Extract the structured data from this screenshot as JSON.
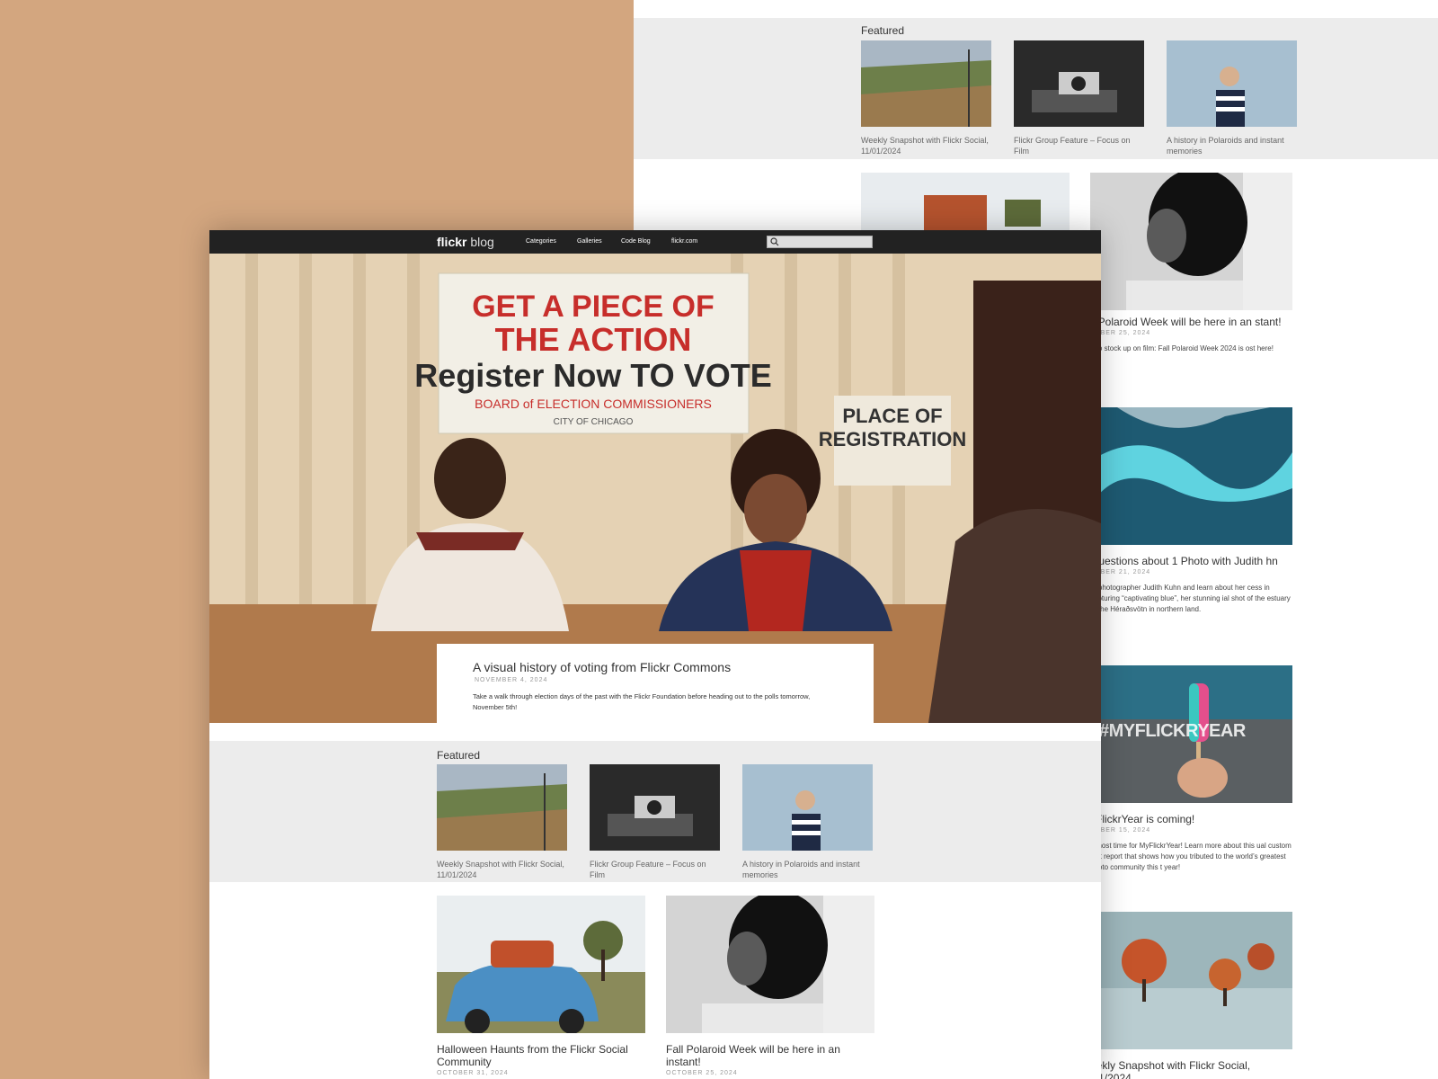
{
  "back": {
    "featured_label": "Featured",
    "featured": [
      {
        "caption": "Weekly Snapshot with Flickr Social, 11/01/2024",
        "image": "landscape-chairlift"
      },
      {
        "caption": "Flickr Group Feature – Focus on Film",
        "image": "camera-on-book"
      },
      {
        "caption": "A history in Polaroids and instant memories",
        "image": "boy-striped-shirt"
      }
    ],
    "posts": [
      {
        "title": "ll Polaroid Week will be here in an stant!",
        "date": "TOBER 25, 2024",
        "excerpt": "e to stock up on film: Fall Polaroid Week 2024 is ost here!"
      },
      {
        "title": " Questions about 1 Photo with Judith hn",
        "date": "TOBER 21, 2024",
        "excerpt": "et photographer Judith Kuhn and learn about her cess in capturing “captivating blue”, her stunning ial shot of the estuary of the Héraðsvötn in northern land."
      },
      {
        "title": "yFlickrYear is coming!",
        "date": "TOBER 15, 2024",
        "excerpt": " almost time for MyFlickrYear! Learn more about this ual custom stat report that shows how you tributed to the world’s greatest photo community this t year!",
        "overlay": "#MYFLICKRYEAR"
      },
      {
        "title": "eekly Snapshot with Flickr Social, /11/2024",
        "date": "",
        "excerpt": ""
      }
    ]
  },
  "front": {
    "nav": {
      "logo_bold": "flickr",
      "logo_light": "blog",
      "links": [
        "Categories",
        "Galleries",
        "Code Blog",
        "flickr.com"
      ],
      "search_placeholder": ""
    },
    "hero": {
      "banner_line1": "GET A PIECE OF",
      "banner_line2": "THE ACTION",
      "banner_line3": "Register Now TO VOTE",
      "banner_line4": "BOARD of ELECTION COMMISSIONERS",
      "banner_line5": "CITY OF CHICAGO",
      "sign_line1": "PLACE OF",
      "sign_line2": "REGISTRATION",
      "title": "A visual history of voting from Flickr Commons",
      "date": "NOVEMBER 4, 2024",
      "excerpt": "Take a walk through election days of the past with the Flickr Foundation before heading out to the polls tomorrow, November 5th!"
    },
    "featured_label": "Featured",
    "featured": [
      {
        "caption": "Weekly Snapshot with Flickr Social, 11/01/2024"
      },
      {
        "caption": "Flickr Group Feature – Focus on Film"
      },
      {
        "caption": "A history in Polaroids and instant memories"
      }
    ],
    "posts": [
      {
        "title": "Halloween Haunts from the Flickr Social Community",
        "date": "OCTOBER 31, 2024"
      },
      {
        "title": "Fall Polaroid Week will be here in an instant!",
        "date": "OCTOBER 25, 2024"
      }
    ]
  },
  "colors": {
    "background": "#d3a67f",
    "nav": "#222222",
    "featured_band": "#ececec"
  }
}
